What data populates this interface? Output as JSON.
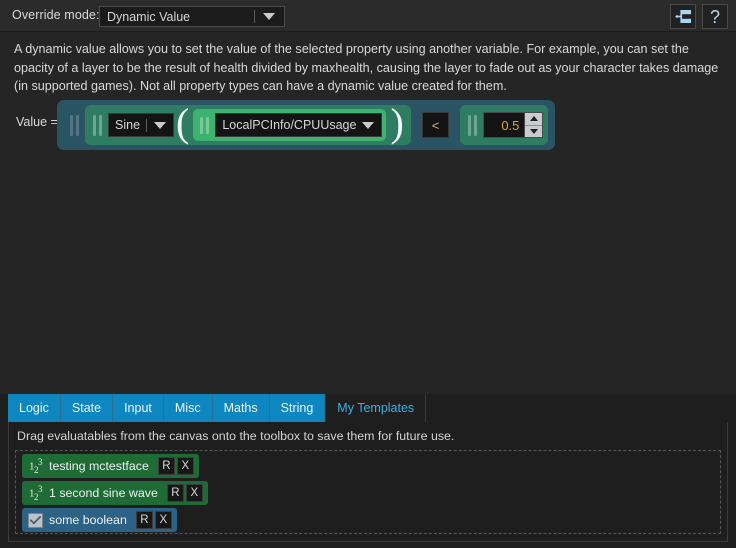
{
  "topbar": {
    "override_mode_label": "Override mode:",
    "override_mode_value": "Dynamic Value",
    "graph_icon": "node-graph-icon",
    "help_icon": "question-mark-icon",
    "help_label": "?"
  },
  "description": "A dynamic value allows you to set the value of the selected property using another variable. For example, you can set the opacity of a layer to be the result of health divided by maxhealth, causing the layer to fade out as your character takes damage (in supported games). Not all property types can have a dynamic value created for them.",
  "expression": {
    "value_label": "Value =",
    "function_name": "Sine",
    "open_paren": "(",
    "data_path": "LocalPCInfo/CPUUsage",
    "close_paren": ")",
    "operator": "<",
    "number_value": "0.5",
    "colors": {
      "root_node": "#2a5364",
      "function_node": "#2e7d63",
      "path_node": "#3eb370",
      "number_text": "#e0a341"
    }
  },
  "toolbox": {
    "tabs": [
      {
        "label": "Logic",
        "selected": false
      },
      {
        "label": "State",
        "selected": false
      },
      {
        "label": "Input",
        "selected": false
      },
      {
        "label": "Misc",
        "selected": false
      },
      {
        "label": "Maths",
        "selected": false
      },
      {
        "label": "String",
        "selected": false
      },
      {
        "label": "My Templates",
        "selected": true
      }
    ],
    "hint": "Drag evaluatables from the canvas onto the toolbox to save them for future use.",
    "templates": [
      {
        "name": "testing mctestface",
        "type": "numeric",
        "icon": "numeric-type-icon",
        "rename_label": "R",
        "delete_label": "X"
      },
      {
        "name": "1 second sine wave",
        "type": "numeric",
        "icon": "numeric-type-icon",
        "rename_label": "R",
        "delete_label": "X"
      },
      {
        "name": "some boolean",
        "type": "boolean",
        "icon": "checkbox-checked-icon",
        "rename_label": "R",
        "delete_label": "X"
      }
    ],
    "accent_color": "#0e87c1",
    "selected_tab_text_color": "#3bb0e5"
  }
}
